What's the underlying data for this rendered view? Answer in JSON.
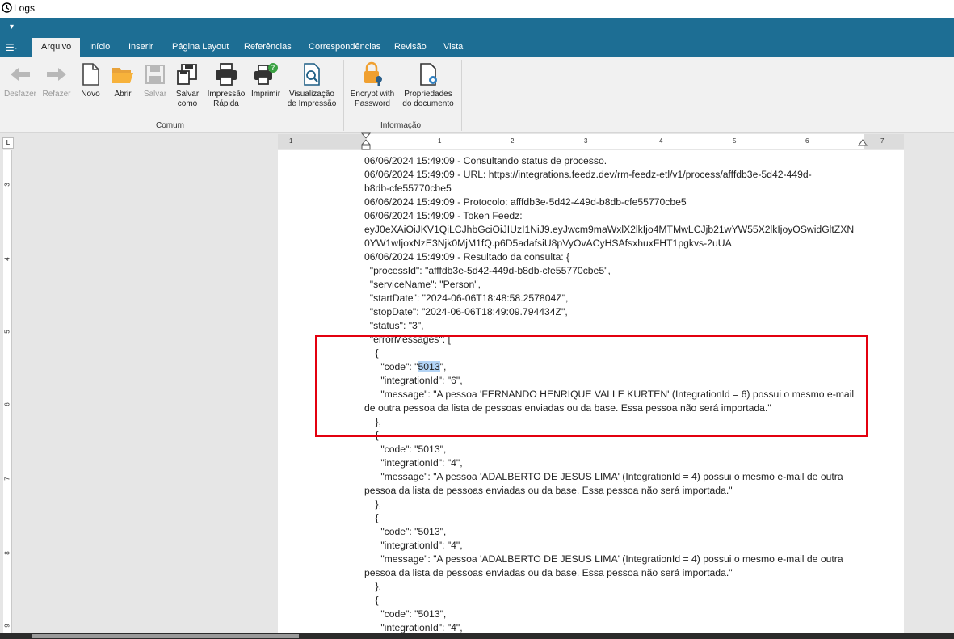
{
  "window": {
    "title": "Logs"
  },
  "qat": {
    "arrow": "▾"
  },
  "app_menu": {
    "label": "☰·"
  },
  "tabs": [
    "Arquivo",
    "Início",
    "Inserir",
    "Página Layout",
    "Referências",
    "Correspondências",
    "Revisão",
    "Vista"
  ],
  "ribbon": {
    "buttons": [
      {
        "label": "Desfazer",
        "icon": "undo-icon",
        "enabled": false
      },
      {
        "label": "Refazer",
        "icon": "redo-icon",
        "enabled": false
      },
      {
        "label": "Novo",
        "icon": "new-document-icon",
        "enabled": true
      },
      {
        "label": "Abrir",
        "icon": "open-folder-icon",
        "enabled": true
      },
      {
        "label": "Salvar",
        "icon": "save-icon",
        "enabled": false
      },
      {
        "label": "Salvar como",
        "icon": "save-as-icon",
        "enabled": true
      },
      {
        "label": "Impressão Rápida",
        "icon": "quick-print-icon",
        "enabled": true
      },
      {
        "label": "Imprimir",
        "icon": "print-icon",
        "enabled": true
      },
      {
        "label": "Visualização de Impressão",
        "icon": "print-preview-icon",
        "enabled": true
      },
      {
        "label": "Encrypt with Password",
        "icon": "lock-key-icon",
        "enabled": true
      },
      {
        "label": "Propriedades do documento",
        "icon": "document-properties-icon",
        "enabled": true
      }
    ],
    "groups": [
      "Comum",
      "Informação"
    ]
  },
  "ruler": {
    "corner": "L",
    "numbers": [
      "1",
      "1",
      "2",
      "3",
      "4",
      "5",
      "6",
      "7"
    ],
    "vertical": [
      "3",
      "4",
      "5",
      "6",
      "7",
      "8",
      "9"
    ]
  },
  "document": {
    "lines": [
      "06/06/2024 15:49:09 - Consultando status de processo.",
      "06/06/2024 15:49:09 - URL: https://integrations.feedz.dev/rm-feedz-etl/v1/process/afffdb3e-5d42-449d-",
      "b8db-cfe55770cbe5",
      "06/06/2024 15:49:09 - Protocolo: afffdb3e-5d42-449d-b8db-cfe55770cbe5",
      "06/06/2024 15:49:09 - Token Feedz:",
      "eyJ0eXAiOiJKV1QiLCJhbGciOiJIUzI1NiJ9.eyJwcm9maWxlX2lkIjo4MTMwLCJjb21wYW55X2lkIjoyOSwidGltZXN",
      "0YW1wIjoxNzE3Njk0MjM1fQ.p6D5adafsiU8pVyOvACyHSAfsxhuxFHT1pgkvs-2uUA",
      "06/06/2024 15:49:09 - Resultado da consulta: {",
      "  \"processId\": \"afffdb3e-5d42-449d-b8db-cfe55770cbe5\",",
      "  \"serviceName\": \"Person\",",
      "  \"startDate\": \"2024-06-06T18:48:58.257804Z\",",
      "  \"stopDate\": \"2024-06-06T18:49:09.794434Z\",",
      "  \"status\": \"3\",",
      "  \"errorMessages\": [",
      "    {",
      "      \"code\": \"5013\",",
      "      \"integrationId\": \"6\",",
      "      \"message\": \"A pessoa 'FERNANDO HENRIQUE VALLE KURTEN' (IntegrationId = 6) possui o mesmo e-mail",
      "de outra pessoa da lista de pessoas enviadas ou da base. Essa pessoa não será importada.\"",
      "    },",
      "    {",
      "      \"code\": \"5013\",",
      "      \"integrationId\": \"4\",",
      "      \"message\": \"A pessoa 'ADALBERTO DE JESUS LIMA' (IntegrationId = 4) possui o mesmo e-mail de outra",
      "pessoa da lista de pessoas enviadas ou da base. Essa pessoa não será importada.\"",
      "    },",
      "    {",
      "      \"code\": \"5013\",",
      "      \"integrationId\": \"4\",",
      "      \"message\": \"A pessoa 'ADALBERTO DE JESUS LIMA' (IntegrationId = 4) possui o mesmo e-mail de outra",
      "pessoa da lista de pessoas enviadas ou da base. Essa pessoa não será importada.\"",
      "    },",
      "    {",
      "      \"code\": \"5013\",",
      "      \"integrationId\": \"4\","
    ],
    "selected_text": "5013"
  },
  "colors": {
    "ribbon_blue": "#1d6e94",
    "annotation_red": "#e3000f",
    "selection": "#b3d4f5"
  }
}
